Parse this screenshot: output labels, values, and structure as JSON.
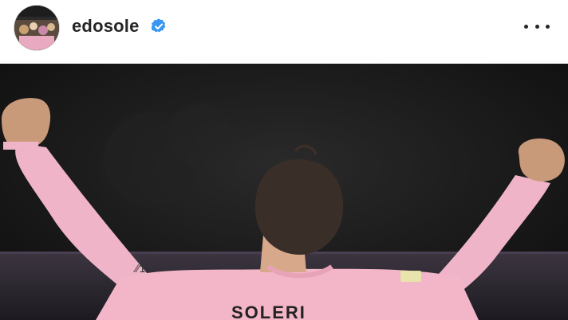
{
  "post": {
    "username": "edosole",
    "verified": true,
    "more_icon": "more-horizontal-icon",
    "avatar_icon": "profile-avatar",
    "image": {
      "description_icon": "post-photo",
      "jersey_text": "SOLERI"
    }
  },
  "colors": {
    "verified_blue": "#3897f0",
    "jersey_pink": "#f2b6c8",
    "text": "#262626"
  }
}
